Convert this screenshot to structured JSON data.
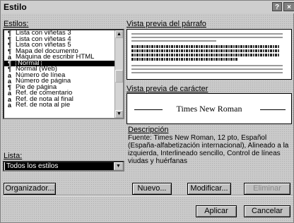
{
  "window": {
    "title": "Estilo",
    "help_label": "?",
    "close_label": "×"
  },
  "styles_label": "Estilos:",
  "styles_list": [
    {
      "mark": "¶",
      "label": "Lista con viñetas 3"
    },
    {
      "mark": "¶",
      "label": "Lista con viñetas 4"
    },
    {
      "mark": "¶",
      "label": "Lista con viñetas 5"
    },
    {
      "mark": "¶",
      "label": "Mapa del documento"
    },
    {
      "mark": "a",
      "label": "Máquina de escribir HTML"
    },
    {
      "mark": "¶",
      "label": "Normal",
      "selected": true
    },
    {
      "mark": "¶",
      "label": "Normal (Web)"
    },
    {
      "mark": "a",
      "label": "Número de línea"
    },
    {
      "mark": "a",
      "label": "Número de página"
    },
    {
      "mark": "¶",
      "label": "Pie de página"
    },
    {
      "mark": "a",
      "label": "Ref. de comentario"
    },
    {
      "mark": "a",
      "label": "Ref. de nota al final"
    },
    {
      "mark": "a",
      "label": "Ref. de nota al pie"
    }
  ],
  "list_label": "Lista:",
  "list_value": "Todos los estilos",
  "paragraph_preview_label": "Vista previa del párrafo",
  "char_preview_label": "Vista previa de carácter",
  "font_preview_text": "Times New Roman",
  "description_label": "Descripción",
  "description_text": "Fuente: Times New Roman, 12 pto, Español (España-alfabetización internacional), Alineado a la izquierda, Interlineado sencillo, Control de líneas viudas y huérfanas",
  "buttons": {
    "organizer": "Organizador...",
    "new": "Nuevo...",
    "modify": "Modificar...",
    "delete": "Eliminar",
    "apply": "Aplicar",
    "cancel": "Cancelar"
  },
  "icons": {
    "help": "help-icon",
    "close": "close-icon",
    "scroll_up": "scroll-up-icon",
    "scroll_down": "scroll-down-icon",
    "dropdown": "dropdown-arrow-icon"
  }
}
